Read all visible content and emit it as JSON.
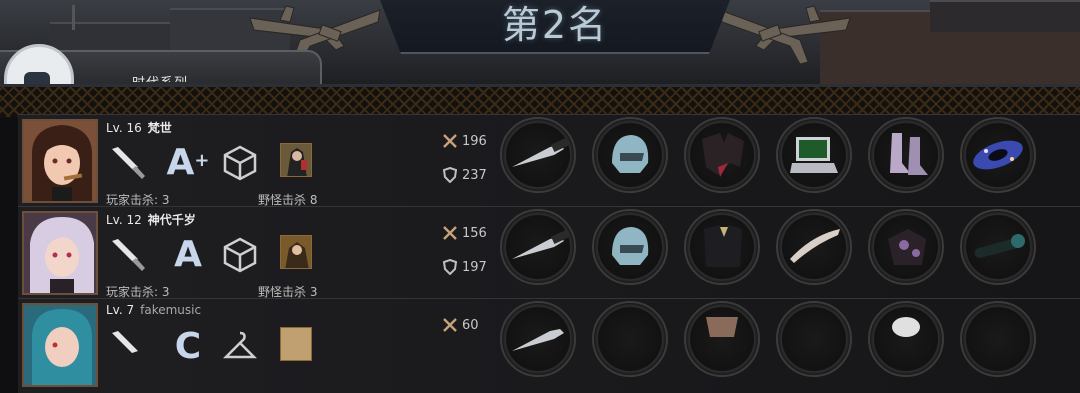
{
  "header": {
    "title": "第2名",
    "rank_tab_label": "时代系列"
  },
  "rows": [
    {
      "level": "Lv. 16",
      "name": "梵世",
      "grade": "A",
      "grade_plus": "+",
      "player_kills": "玩家击杀: 3",
      "monster_kills": "野怪击杀 8",
      "attack": "196",
      "defense": "237",
      "equipment": [
        "knife-icon",
        "helmet-icon",
        "coat-icon",
        "laptop-icon",
        "boots-icon",
        "galaxy-icon"
      ]
    },
    {
      "level": "Lv. 12",
      "name": "神代千岁",
      "grade": "A",
      "grade_plus": "",
      "player_kills": "玩家击杀: 3",
      "monster_kills": "野怪击杀 3",
      "attack": "156",
      "defense": "197",
      "equipment": [
        "knife-icon",
        "helmet-icon",
        "coat-icon",
        "blade-icon",
        "gauntlet-icon",
        "scope-icon"
      ]
    },
    {
      "level": "Lv. 7",
      "name": "fakemusic",
      "grade": "C",
      "grade_plus": "",
      "attack": "60"
    }
  ],
  "colors": {
    "accent": "#b9cad6",
    "frame": "#6d4f3a",
    "lattice": "#3a2a18"
  }
}
